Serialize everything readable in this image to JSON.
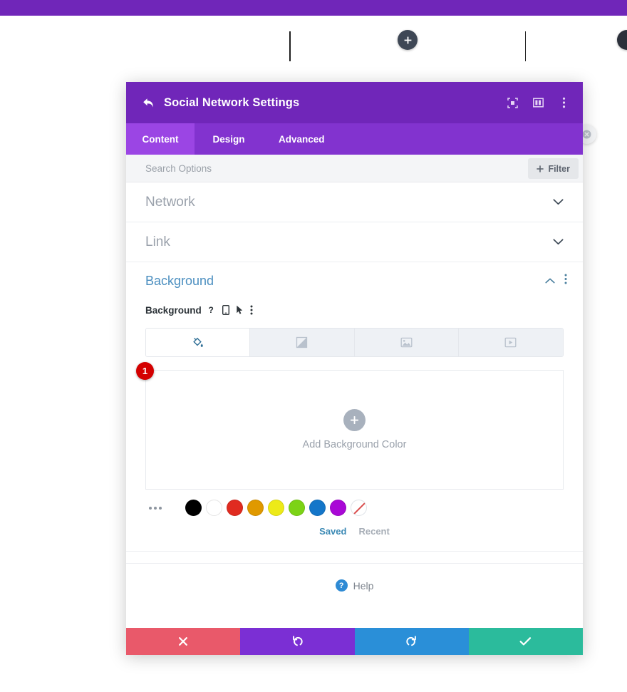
{
  "builder": {
    "add_module_icon": "plus-icon",
    "edge_button_icon": "circle-button-icon"
  },
  "modal": {
    "back_icon": "back-arrow-icon",
    "title": "Social Network Settings",
    "header_icons": [
      {
        "name": "expand-view-icon"
      },
      {
        "name": "split-view-icon"
      },
      {
        "name": "more-options-icon"
      }
    ],
    "tabs": [
      {
        "label": "Content",
        "active": true
      },
      {
        "label": "Design",
        "active": false
      },
      {
        "label": "Advanced",
        "active": false
      }
    ],
    "search": {
      "placeholder": "Search Options",
      "value": ""
    },
    "filter_button": {
      "label": "Filter",
      "icon": "plus-icon"
    },
    "accordions": [
      {
        "label": "Network",
        "chevron": "chevron-down-icon"
      },
      {
        "label": "Link",
        "chevron": "chevron-down-icon"
      }
    ],
    "background_section": {
      "title": "Background",
      "collapse_icon": "chevron-up-icon",
      "more_icon": "more-options-icon",
      "field_label": "Background",
      "field_icons": [
        {
          "name": "help-question-icon",
          "glyph": "?"
        },
        {
          "name": "responsive-mobile-icon"
        },
        {
          "name": "hover-cursor-icon"
        },
        {
          "name": "field-more-options-icon"
        }
      ],
      "type_tabs": [
        {
          "name": "background-color-tab",
          "icon": "paint-bucket-icon",
          "active": true
        },
        {
          "name": "background-gradient-tab",
          "icon": "gradient-icon",
          "active": false
        },
        {
          "name": "background-image-tab",
          "icon": "image-icon",
          "active": false
        },
        {
          "name": "background-video-tab",
          "icon": "video-icon",
          "active": false
        }
      ],
      "dropzone": {
        "badge": "1",
        "plus_icon": "plus-icon",
        "label": "Add Background Color"
      },
      "swatch_more_icon": "ellipsis-icon",
      "swatches": [
        {
          "name": "swatch-black",
          "color": "#000000"
        },
        {
          "name": "swatch-white",
          "color": "#ffffff"
        },
        {
          "name": "swatch-red",
          "color": "#e02b20"
        },
        {
          "name": "swatch-orange",
          "color": "#e09900"
        },
        {
          "name": "swatch-yellow",
          "color": "#edea18"
        },
        {
          "name": "swatch-green",
          "color": "#7cd316"
        },
        {
          "name": "swatch-blue",
          "color": "#1476c9"
        },
        {
          "name": "swatch-purple",
          "color": "#a908d6"
        },
        {
          "name": "swatch-none",
          "color": "transparent"
        }
      ],
      "palette_tabs": [
        {
          "label": "Saved",
          "active": true
        },
        {
          "label": "Recent",
          "active": false
        }
      ]
    },
    "help": {
      "icon": "help-question-icon",
      "label": "Help"
    },
    "footer_buttons": [
      {
        "name": "cancel-button",
        "icon": "close-x-icon",
        "color": "#e9596a"
      },
      {
        "name": "undo-button",
        "icon": "undo-icon",
        "color": "#7b2fd4"
      },
      {
        "name": "redo-button",
        "icon": "redo-icon",
        "color": "#2a8fd8"
      },
      {
        "name": "save-button",
        "icon": "checkmark-icon",
        "color": "#2bbb9c"
      }
    ],
    "close_button_icon": "close-circle-icon"
  },
  "colors": {
    "header_purple": "#7026b9",
    "tabs_purple": "#8233cf",
    "active_tab_purple": "#9b45e4",
    "accent_blue": "#4c8fc0",
    "badge_red": "#d40000"
  }
}
